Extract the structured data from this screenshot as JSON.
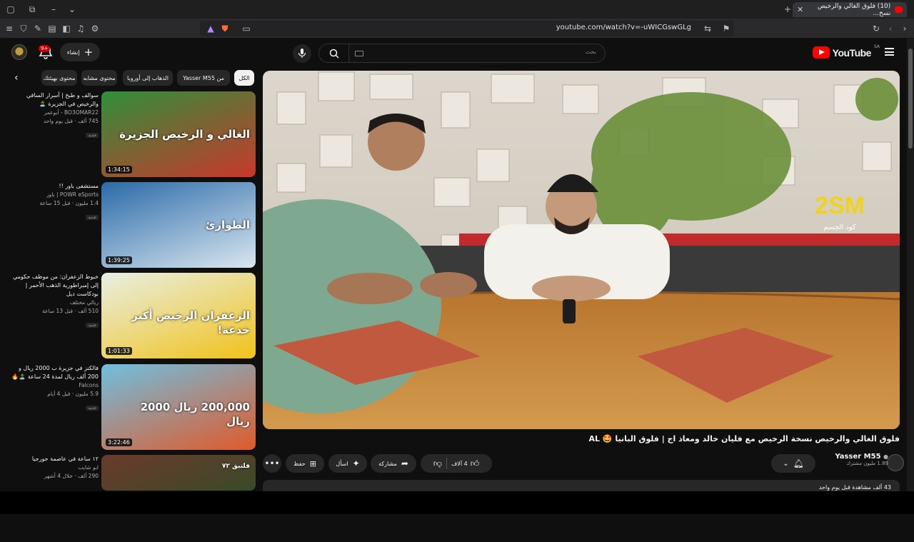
{
  "browser": {
    "tab_title": "(10) فلوق الغالي والرخيص نسخ...",
    "url": "youtube.com/watch?v=-uWICGswGLg"
  },
  "header": {
    "logo": "YouTube",
    "region": "SA",
    "search_placeholder": "بحث",
    "create_label": "إنشاء",
    "notif_count": "9+"
  },
  "chips": [
    "الكل",
    "من Yasser M55",
    "الذهاب إلى أوروبا",
    "محتوى مشابه",
    "محتوى بهيئتك"
  ],
  "recommendations": [
    {
      "title": "سوالف و طبخ | أسرار الساقي والرخيص في الجزيرة 🏝️",
      "channel": "BO3OMAR22 - أبوعمر",
      "stats": "745 ألف · قبل يوم واحد",
      "tag": "جديد",
      "duration": "1:34:15",
      "thumb_text": "الغالي و الرخيص الجزيرة",
      "colors": [
        "#2f8f3a",
        "#c8382c"
      ]
    },
    {
      "title": "مستشفى باور !!",
      "channel": "POWR eSports | باور",
      "stats": "1.4 مليون · قبل 15 ساعة",
      "tag": "جديد",
      "duration": "1:39:25",
      "thumb_text": "الطوارئ",
      "colors": [
        "#2b6aa8",
        "#d9e7f0"
      ]
    },
    {
      "title": "خبوط الزعفران: من موظف حكومي إلى إمبراطورية الذهب الأحمر | بودكاست ديل",
      "channel": "ريالي مختلف",
      "stats": "510 ألف · قبل 13 ساعة",
      "tag": "جديد",
      "duration": "1:01:33",
      "thumb_text": "الزعفران الرخيص أكبر خدعة!",
      "colors": [
        "#e8efe3",
        "#f1c21b"
      ]
    },
    {
      "title": "فالكنز في جزيرة ب 2000 ريال و 200 ألف ريال لمدة 24 ساعة 🏝️🔥",
      "channel": "Falcons",
      "stats": "5.9 مليون · قبل 4 أيام",
      "tag": "جديد",
      "duration": "3:22:46",
      "thumb_text": "200,000 ريال  2000 ريال",
      "colors": [
        "#6fbfe0",
        "#e05a2a"
      ]
    },
    {
      "title": "١٢ ساعة في عاصمة جورجيا",
      "channel": "ابو شايب",
      "stats": "290 ألف · خلال 4 أشهر",
      "tag": "",
      "duration": "",
      "thumb_text": "فلتبق ٧٢",
      "colors": [
        "#6b3a2a",
        "#3a4a2a"
      ]
    }
  ],
  "video": {
    "title": "فلوق الغالي والرخيص نسخة الرخيص مع فليان خالد ومعاذ اج | فلوق البانيا 🤩 AL",
    "watermark": "2SM",
    "watermark_sub": "كود الجسم",
    "channel_name": "Yasser M55",
    "subscribers": "1.89 مليون مشترك",
    "likes": "4 آلاف",
    "share_label": "مشاركة",
    "ask_label": "اسأل",
    "save_label": "حفظ",
    "views_line": "43 ألف مشاهدة  قبل يوم واحد"
  }
}
